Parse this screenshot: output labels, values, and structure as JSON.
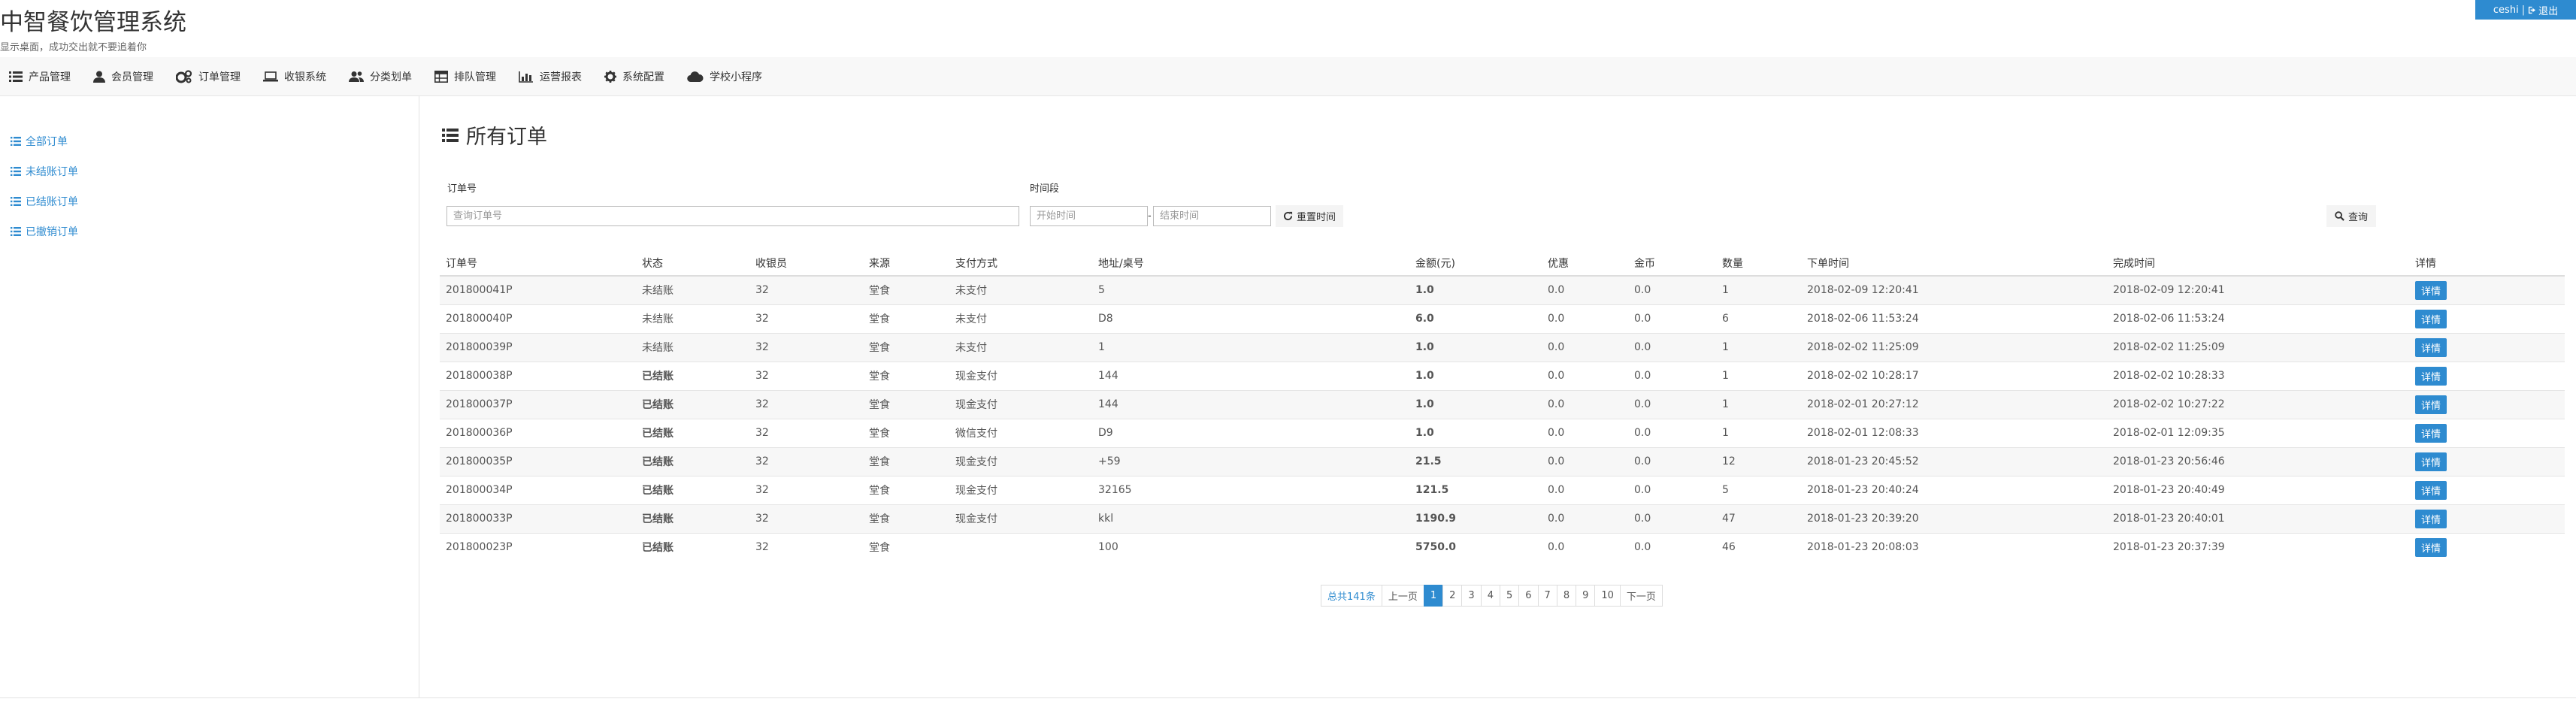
{
  "header": {
    "title": "中智餐饮管理系统",
    "subtitle": "显示桌面，成功交出就不要追着你",
    "user": "ceshi",
    "separator": "|",
    "logout": "退出"
  },
  "nav": [
    {
      "label": "产品管理",
      "icon": "list-icon"
    },
    {
      "label": "会员管理",
      "icon": "user-icon"
    },
    {
      "label": "订单管理",
      "icon": "cogs-icon"
    },
    {
      "label": "收银系统",
      "icon": "laptop-icon"
    },
    {
      "label": "分类划单",
      "icon": "users-icon"
    },
    {
      "label": "排队管理",
      "icon": "table-icon"
    },
    {
      "label": "运营报表",
      "icon": "bar-chart-icon"
    },
    {
      "label": "系统配置",
      "icon": "gear-icon"
    },
    {
      "label": "学校小程序",
      "icon": "cloud-icon"
    }
  ],
  "sidebar": [
    {
      "label": "全部订单"
    },
    {
      "label": "未结账订单"
    },
    {
      "label": "已结账订单"
    },
    {
      "label": "已撤销订单"
    }
  ],
  "main": {
    "title": "所有订单",
    "order_no_label": "订单号",
    "order_no_placeholder": "查询订单号",
    "period_label": "时间段",
    "start_placeholder": "开始时间",
    "dash": "-",
    "end_placeholder": "结束时间",
    "reset_label": "重置时间",
    "search_label": "查询"
  },
  "table": {
    "headers": [
      "订单号",
      "状态",
      "收银员",
      "来源",
      "支付方式",
      "地址/桌号",
      "金额(元)",
      "优惠",
      "金币",
      "数量",
      "下单时间",
      "完成时间",
      "详情"
    ],
    "rows": [
      {
        "order": "201800041P",
        "status": "未结账",
        "status_type": "unsettled",
        "cashier": "32",
        "source": "堂食",
        "pay": "未支付",
        "addr": "5",
        "amount": "1.0",
        "discount": "0.0",
        "coins": "0.0",
        "qty": "1",
        "ordered": "2018-02-09 12:20:41",
        "completed": "2018-02-09 12:20:41",
        "detail": "详情"
      },
      {
        "order": "201800040P",
        "status": "未结账",
        "status_type": "unsettled",
        "cashier": "32",
        "source": "堂食",
        "pay": "未支付",
        "addr": "D8",
        "amount": "6.0",
        "discount": "0.0",
        "coins": "0.0",
        "qty": "6",
        "ordered": "2018-02-06 11:53:24",
        "completed": "2018-02-06 11:53:24",
        "detail": "详情"
      },
      {
        "order": "201800039P",
        "status": "未结账",
        "status_type": "unsettled",
        "cashier": "32",
        "source": "堂食",
        "pay": "未支付",
        "addr": "1",
        "amount": "1.0",
        "discount": "0.0",
        "coins": "0.0",
        "qty": "1",
        "ordered": "2018-02-02 11:25:09",
        "completed": "2018-02-02 11:25:09",
        "detail": "详情"
      },
      {
        "order": "201800038P",
        "status": "已结账",
        "status_type": "settled",
        "cashier": "32",
        "source": "堂食",
        "pay": "现金支付",
        "addr": "144",
        "amount": "1.0",
        "discount": "0.0",
        "coins": "0.0",
        "qty": "1",
        "ordered": "2018-02-02 10:28:17",
        "completed": "2018-02-02 10:28:33",
        "detail": "详情"
      },
      {
        "order": "201800037P",
        "status": "已结账",
        "status_type": "settled",
        "cashier": "32",
        "source": "堂食",
        "pay": "现金支付",
        "addr": "144",
        "amount": "1.0",
        "discount": "0.0",
        "coins": "0.0",
        "qty": "1",
        "ordered": "2018-02-01 20:27:12",
        "completed": "2018-02-02 10:27:22",
        "detail": "详情"
      },
      {
        "order": "201800036P",
        "status": "已结账",
        "status_type": "settled",
        "cashier": "32",
        "source": "堂食",
        "pay": "微信支付",
        "addr": "D9",
        "amount": "1.0",
        "discount": "0.0",
        "coins": "0.0",
        "qty": "1",
        "ordered": "2018-02-01 12:08:33",
        "completed": "2018-02-01 12:09:35",
        "detail": "详情"
      },
      {
        "order": "201800035P",
        "status": "已结账",
        "status_type": "settled",
        "cashier": "32",
        "source": "堂食",
        "pay": "现金支付",
        "addr": "+59",
        "amount": "21.5",
        "discount": "0.0",
        "coins": "0.0",
        "qty": "12",
        "ordered": "2018-01-23 20:45:52",
        "completed": "2018-01-23 20:56:46",
        "detail": "详情"
      },
      {
        "order": "201800034P",
        "status": "已结账",
        "status_type": "settled",
        "cashier": "32",
        "source": "堂食",
        "pay": "现金支付",
        "addr": "32165",
        "amount": "121.5",
        "discount": "0.0",
        "coins": "0.0",
        "qty": "5",
        "ordered": "2018-01-23 20:40:24",
        "completed": "2018-01-23 20:40:49",
        "detail": "详情"
      },
      {
        "order": "201800033P",
        "status": "已结账",
        "status_type": "settled",
        "cashier": "32",
        "source": "堂食",
        "pay": "现金支付",
        "addr": "kkl",
        "amount": "1190.9",
        "discount": "0.0",
        "coins": "0.0",
        "qty": "47",
        "ordered": "2018-01-23 20:39:20",
        "completed": "2018-01-23 20:40:01",
        "detail": "详情"
      },
      {
        "order": "201800023P",
        "status": "已结账",
        "status_type": "settled",
        "cashier": "32",
        "source": "堂食",
        "pay": "",
        "addr": "100",
        "amount": "5750.0",
        "discount": "0.0",
        "coins": "0.0",
        "qty": "46",
        "ordered": "2018-01-23 20:08:03",
        "completed": "2018-01-23 20:37:39",
        "detail": "详情"
      }
    ]
  },
  "pagination": {
    "total": "总共141条",
    "prev": "上一页",
    "pages": [
      "1",
      "2",
      "3",
      "4",
      "5",
      "6",
      "7",
      "8",
      "9",
      "10"
    ],
    "current": "1",
    "next": "下一页"
  },
  "colors": {
    "accent": "#2e8bd0",
    "unsettled": "#f0a500",
    "settled": "#2a9a1c",
    "amount": "#cc0000"
  }
}
